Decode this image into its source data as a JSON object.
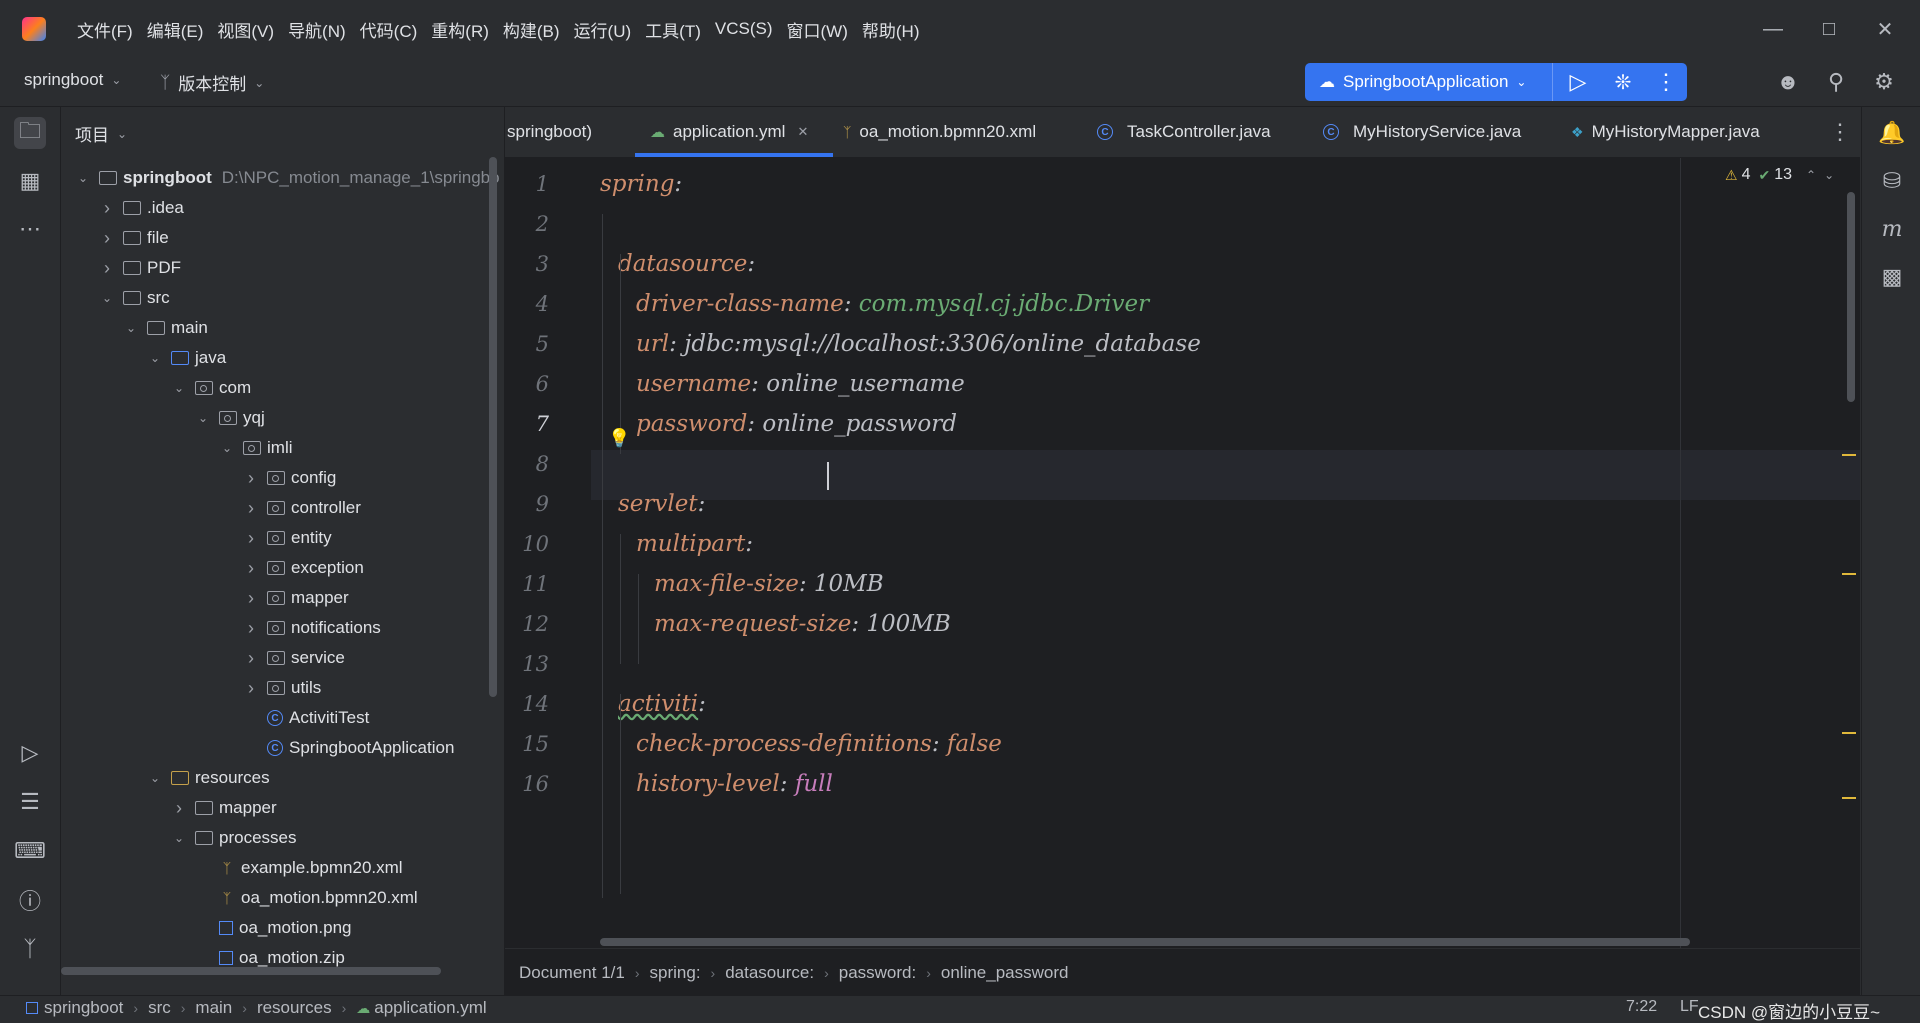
{
  "menu": [
    "文件(F)",
    "编辑(E)",
    "视图(V)",
    "导航(N)",
    "代码(C)",
    "重构(R)",
    "构建(B)",
    "运行(U)",
    "工具(T)",
    "VCS(S)",
    "窗口(W)",
    "帮助(H)"
  ],
  "toolbar": {
    "project_name": "springboot",
    "vcs_label": "版本控制",
    "run_config": "SpringbootApplication"
  },
  "project_panel": {
    "title": "项目",
    "root_name": "springboot",
    "root_path": "D:\\NPC_motion_manage_1\\springbo",
    "items": [
      {
        "label": ".idea"
      },
      {
        "label": "file"
      },
      {
        "label": "PDF"
      },
      {
        "label": "src"
      },
      {
        "label": "main"
      },
      {
        "label": "java"
      },
      {
        "label": "com"
      },
      {
        "label": "yqj"
      },
      {
        "label": "imli"
      },
      {
        "label": "config"
      },
      {
        "label": "controller"
      },
      {
        "label": "entity"
      },
      {
        "label": "exception"
      },
      {
        "label": "mapper"
      },
      {
        "label": "notifications"
      },
      {
        "label": "service"
      },
      {
        "label": "utils"
      },
      {
        "label": "ActivitiTest"
      },
      {
        "label": "SpringbootApplication"
      },
      {
        "label": "resources"
      },
      {
        "label": "mapper"
      },
      {
        "label": "processes"
      },
      {
        "label": "example.bpmn20.xml"
      },
      {
        "label": "oa_motion.bpmn20.xml"
      },
      {
        "label": "oa_motion.png"
      },
      {
        "label": "oa_motion.zip"
      }
    ]
  },
  "tabs": [
    {
      "label": "springboot)"
    },
    {
      "label": "application.yml"
    },
    {
      "label": "oa_motion.bpmn20.xml"
    },
    {
      "label": "TaskController.java"
    },
    {
      "label": "MyHistoryService.java"
    },
    {
      "label": "MyHistoryMapper.java"
    }
  ],
  "inspections": {
    "warnings": "4",
    "ok": "13"
  },
  "code": [
    {
      "n": "1",
      "key": "spring",
      "val": ""
    },
    {
      "n": "2",
      "key": "",
      "val": ""
    },
    {
      "n": "3",
      "key": "datasource",
      "val": ""
    },
    {
      "n": "4",
      "key": "driver-class-name",
      "val": "com.mysql.cj.jdbc.Driver"
    },
    {
      "n": "5",
      "key": "url",
      "val": "jdbc:mysql://localhost:3306/online_database"
    },
    {
      "n": "6",
      "key": "username",
      "val": "online_username"
    },
    {
      "n": "7",
      "key": "password",
      "val": "online_password"
    },
    {
      "n": "8",
      "key": "",
      "val": ""
    },
    {
      "n": "9",
      "key": "servlet",
      "val": ""
    },
    {
      "n": "10",
      "key": "multipart",
      "val": ""
    },
    {
      "n": "11",
      "key": "max-file-size",
      "val": "10MB"
    },
    {
      "n": "12",
      "key": "max-request-size",
      "val": "100MB"
    },
    {
      "n": "13",
      "key": "",
      "val": ""
    },
    {
      "n": "14",
      "key": "activiti",
      "val": ""
    },
    {
      "n": "15",
      "key": "check-process-definitions",
      "val": "false"
    },
    {
      "n": "16",
      "key": "history-level",
      "val": "full"
    }
  ],
  "breadcrumbs": [
    "Document 1/1",
    "spring:",
    "datasource:",
    "password:",
    "online_password"
  ],
  "status": {
    "path": [
      "springboot",
      "src",
      "main",
      "resources",
      "application.yml"
    ],
    "position": "7:22",
    "line_sep": "LF",
    "watermark": "CSDN @窗边的小豆豆~"
  }
}
